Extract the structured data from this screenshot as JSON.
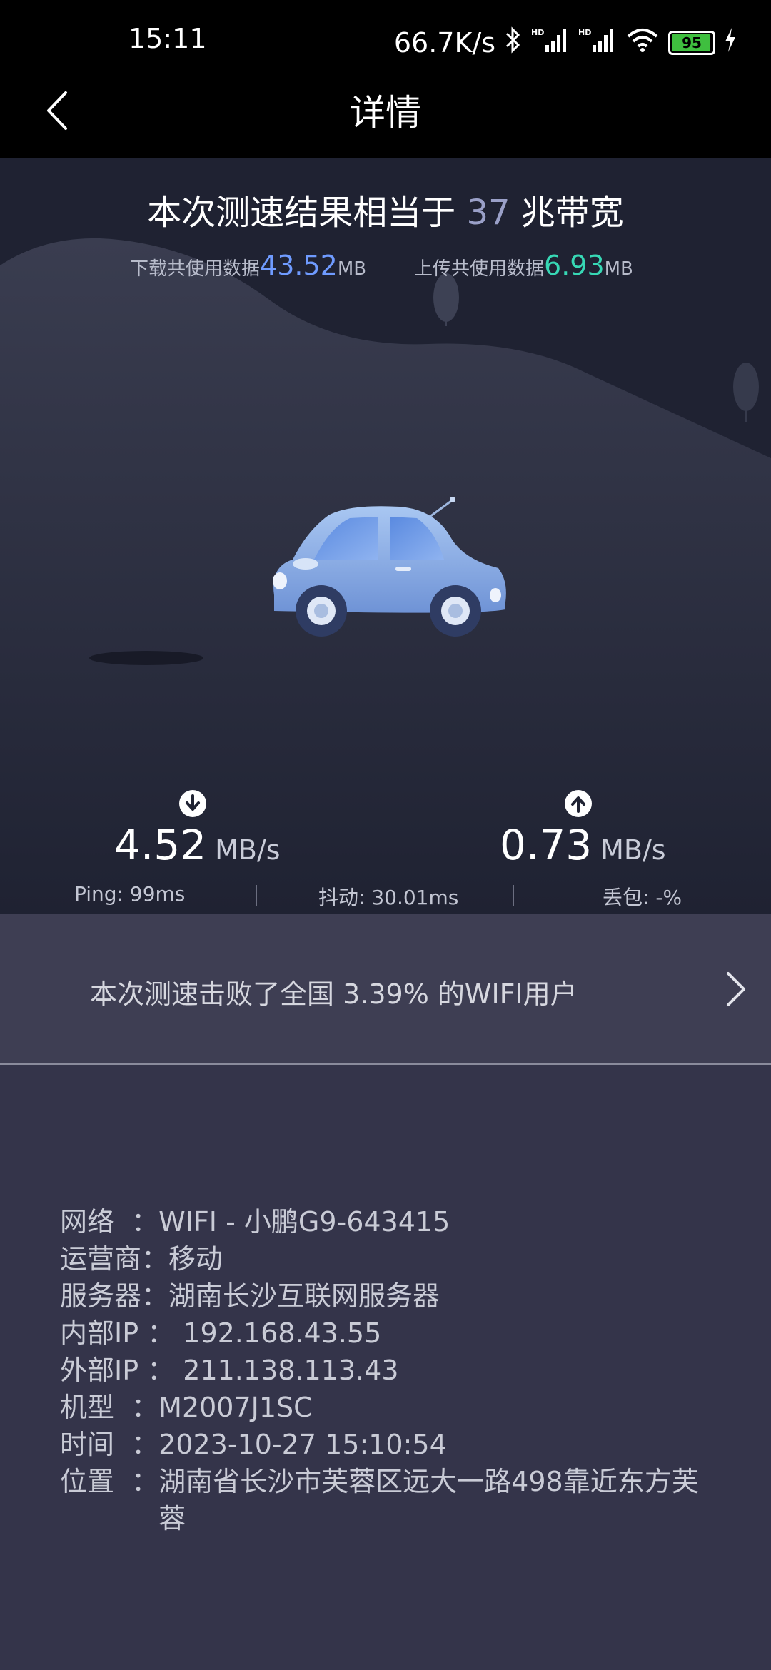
{
  "status_bar": {
    "time": "15:11",
    "net_speed": "66.7K/s",
    "battery": "95",
    "icons": [
      "bluetooth-icon",
      "hd-signal-icon",
      "hd-signal-icon",
      "wifi-icon",
      "battery-icon",
      "charging-icon"
    ]
  },
  "header": {
    "title": "详情",
    "back_icon": "chevron-left-icon"
  },
  "summary": {
    "prefix": "本次测速结果相当于 ",
    "bandwidth": "37",
    "suffix": " 兆带宽",
    "download_label": "下载共使用数据",
    "download_value": "43.52",
    "download_unit": "MB",
    "upload_label": "上传共使用数据",
    "upload_value": "6.93",
    "upload_unit": "MB"
  },
  "speed": {
    "download_value": "4.52",
    "download_unit": "MB/s",
    "upload_value": "0.73",
    "upload_unit": "MB/s",
    "ping": "Ping: 99ms",
    "jitter": "抖动: 30.01ms",
    "loss": "丢包: -%"
  },
  "beat": {
    "text": "本次测速击败了全国 3.39% 的WIFI用户"
  },
  "info": [
    {
      "label": "网络  ：",
      "value": "WIFI - 小鹏G9-643415"
    },
    {
      "label": "运营商：",
      "value": "移动"
    },
    {
      "label": "服务器：",
      "value": "湖南长沙互联网服务器"
    },
    {
      "label": "内部IP ： ",
      "value": "192.168.43.55"
    },
    {
      "label": "外部IP ： ",
      "value": "211.138.113.43"
    },
    {
      "label": "机型  ：",
      "value": "M2007J1SC"
    },
    {
      "label": "时间  ：",
      "value": "2023-10-27 15:10:54"
    },
    {
      "label": "位置  ：",
      "value": "湖南省长沙市芙蓉区远大一路498靠近东方芙蓉"
    }
  ],
  "colors": {
    "download_accent": "#6f9bff",
    "upload_accent": "#37d8b5",
    "hero_bg": "#1f2232",
    "page_bg": "#34344a"
  }
}
